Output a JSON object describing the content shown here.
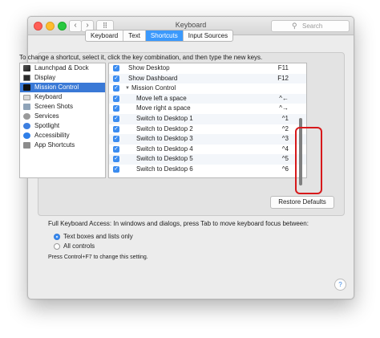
{
  "window": {
    "title": "Keyboard",
    "search_placeholder": "Search"
  },
  "nav": {
    "back": "‹",
    "forward": "›",
    "grid": "⠿"
  },
  "tabs": [
    {
      "label": "Keyboard",
      "active": false
    },
    {
      "label": "Text",
      "active": false
    },
    {
      "label": "Shortcuts",
      "active": true
    },
    {
      "label": "Input Sources",
      "active": false
    }
  ],
  "instruction": "To change a shortcut, select it, click the key combination, and then type the new keys.",
  "categories": [
    {
      "label": "Launchpad & Dock",
      "icon": "launchpad-icon",
      "selected": false
    },
    {
      "label": "Display",
      "icon": "display-icon",
      "selected": false
    },
    {
      "label": "Mission Control",
      "icon": "mission-control-icon",
      "selected": true
    },
    {
      "label": "Keyboard",
      "icon": "keyboard-icon",
      "selected": false
    },
    {
      "label": "Screen Shots",
      "icon": "screenshot-icon",
      "selected": false
    },
    {
      "label": "Services",
      "icon": "gear-icon",
      "selected": false
    },
    {
      "label": "Spotlight",
      "icon": "spotlight-icon",
      "selected": false
    },
    {
      "label": "Accessibility",
      "icon": "accessibility-icon",
      "selected": false
    },
    {
      "label": "App Shortcuts",
      "icon": "app-shortcuts-icon",
      "selected": false
    }
  ],
  "shortcuts": [
    {
      "name": "Show Desktop",
      "key": "F11",
      "checked": true,
      "indent": 0
    },
    {
      "name": "Show Dashboard",
      "key": "F12",
      "checked": true,
      "indent": 0
    },
    {
      "name": "Mission Control",
      "key": "",
      "checked": true,
      "indent": 0,
      "group": true
    },
    {
      "name": "Move left a space",
      "key": "^←",
      "checked": true,
      "indent": 1
    },
    {
      "name": "Move right a space",
      "key": "^→",
      "checked": true,
      "indent": 1
    },
    {
      "name": "Switch to Desktop 1",
      "key": "^1",
      "checked": true,
      "indent": 1
    },
    {
      "name": "Switch to Desktop 2",
      "key": "^2",
      "checked": true,
      "indent": 1
    },
    {
      "name": "Switch to Desktop 3",
      "key": "^3",
      "checked": true,
      "indent": 1
    },
    {
      "name": "Switch to Desktop 4",
      "key": "^4",
      "checked": true,
      "indent": 1
    },
    {
      "name": "Switch to Desktop 5",
      "key": "^5",
      "checked": true,
      "indent": 1
    },
    {
      "name": "Switch to Desktop 6",
      "key": "^6",
      "checked": true,
      "indent": 1
    }
  ],
  "restore_button": "Restore Defaults",
  "full_keyboard_access": {
    "label": "Full Keyboard Access: In windows and dialogs, press Tab to move keyboard focus between:",
    "options": [
      {
        "label": "Text boxes and lists only",
        "selected": true
      },
      {
        "label": "All controls",
        "selected": false
      }
    ],
    "note": "Press Control+F7 to change this setting."
  },
  "help_button": "?",
  "colors": {
    "accent": "#3b99fc",
    "selection": "#3a79d6",
    "highlight_annotation": "#d7191b"
  }
}
